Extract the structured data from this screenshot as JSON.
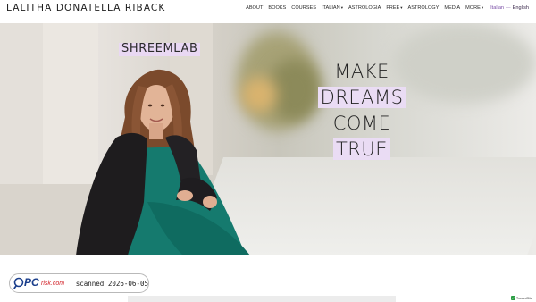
{
  "header": {
    "brand": "LALITHA DONATELLA RIBACK",
    "nav": [
      {
        "label": "ABOUT",
        "dropdown": false
      },
      {
        "label": "BOOKS",
        "dropdown": false
      },
      {
        "label": "COURSES",
        "dropdown": false
      },
      {
        "label": "ITALIAN",
        "dropdown": true
      },
      {
        "label": "ASTROLOGIA",
        "dropdown": false
      },
      {
        "label": "FREE",
        "dropdown": true
      },
      {
        "label": "ASTROLOGY",
        "dropdown": false
      },
      {
        "label": "MEDIA",
        "dropdown": false
      },
      {
        "label": "MORE",
        "dropdown": true
      }
    ],
    "language": {
      "italian": "Italian",
      "separator": "—",
      "english": "English"
    }
  },
  "hero": {
    "tag": "SHREEMLAB",
    "headline": [
      "MAKE",
      "DREAMS",
      "COME",
      "TRUE"
    ],
    "highlighted_lines": [
      1,
      3
    ]
  },
  "badge": {
    "logo_pc": "PC",
    "logo_risk": "risk.com",
    "scanned_text": "scanned 2026-06-05"
  },
  "trusted": {
    "label": "TrustedSite"
  },
  "colors": {
    "highlight": "#e9d8f3",
    "lang_accent": "#7a4ea6",
    "pcrisk_blue": "#1b3f8c",
    "pcrisk_red": "#d3262c"
  }
}
